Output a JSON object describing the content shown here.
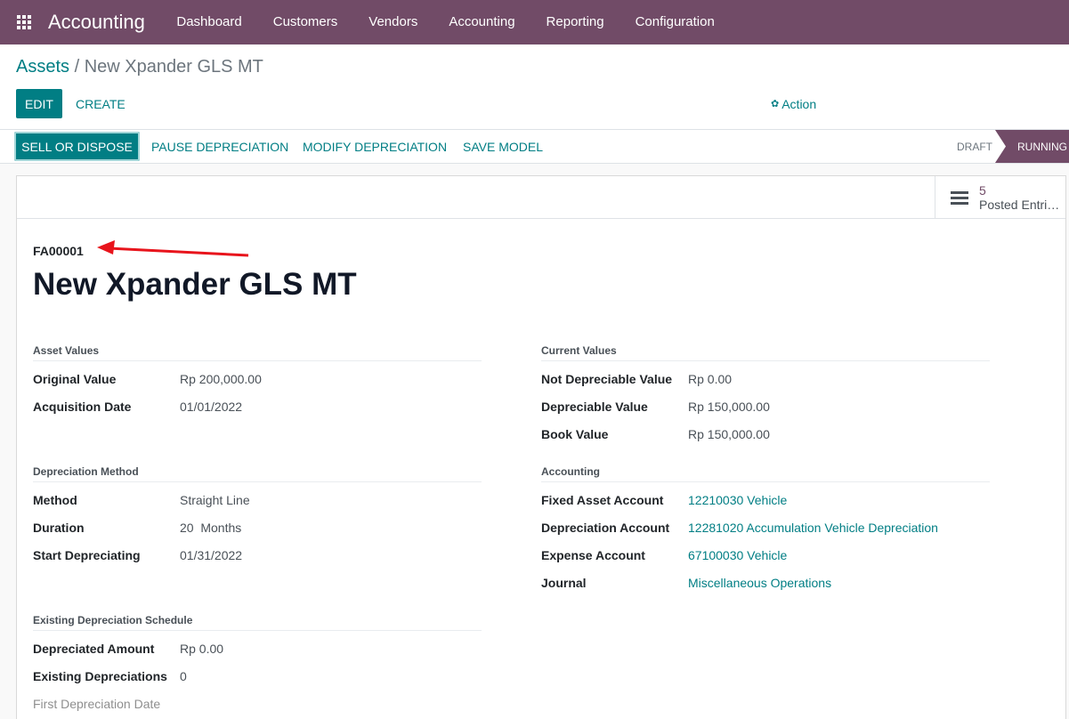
{
  "navbar": {
    "brand": "Accounting",
    "menu": [
      "Dashboard",
      "Customers",
      "Vendors",
      "Accounting",
      "Reporting",
      "Configuration"
    ]
  },
  "breadcrumb": {
    "parent": "Assets",
    "separator": " / ",
    "current": "New Xpander GLS MT"
  },
  "toolbar": {
    "edit": "EDIT",
    "create": "CREATE",
    "action": "Action"
  },
  "statusbar": {
    "buttons": [
      "SELL OR DISPOSE",
      "PAUSE DEPRECIATION",
      "MODIFY DEPRECIATION",
      "SAVE MODEL"
    ],
    "stages": [
      "DRAFT",
      "RUNNING"
    ]
  },
  "stat_button": {
    "value": "5",
    "label": "Posted Entri…"
  },
  "record": {
    "reference": "FA00001",
    "name": "New Xpander GLS MT"
  },
  "asset_values": {
    "title": "Asset Values",
    "rows": [
      {
        "label": "Original Value",
        "value": "Rp 200,000.00"
      },
      {
        "label": "Acquisition Date",
        "value": "01/01/2022"
      }
    ]
  },
  "current_values": {
    "title": "Current Values",
    "rows": [
      {
        "label": "Not Depreciable Value",
        "value": "Rp 0.00"
      },
      {
        "label": "Depreciable Value",
        "value": "Rp 150,000.00"
      },
      {
        "label": "Book Value",
        "value": "Rp 150,000.00"
      }
    ]
  },
  "depreciation_method": {
    "title": "Depreciation Method",
    "rows": [
      {
        "label": "Method",
        "value": "Straight Line"
      },
      {
        "label": "Duration",
        "value": "20  Months"
      },
      {
        "label": "Start Depreciating",
        "value": "01/31/2022"
      }
    ]
  },
  "accounting": {
    "title": "Accounting",
    "rows": [
      {
        "label": "Fixed Asset Account",
        "value": "12210030 Vehicle"
      },
      {
        "label": "Depreciation Account",
        "value": "12281020 Accumulation Vehicle Depreciation"
      },
      {
        "label": "Expense Account",
        "value": "67100030 Vehicle"
      },
      {
        "label": "Journal",
        "value": "Miscellaneous Operations"
      }
    ]
  },
  "existing_schedule": {
    "title": "Existing Depreciation Schedule",
    "rows": [
      {
        "label": "Depreciated Amount",
        "value": "Rp 0.00"
      },
      {
        "label": "Existing Depreciations",
        "value": "0"
      },
      {
        "label": "First Depreciation Date",
        "value": ""
      }
    ]
  },
  "colors": {
    "brand": "#714b67",
    "accent": "#017e84",
    "annotation_arrow": "#e8141c"
  }
}
